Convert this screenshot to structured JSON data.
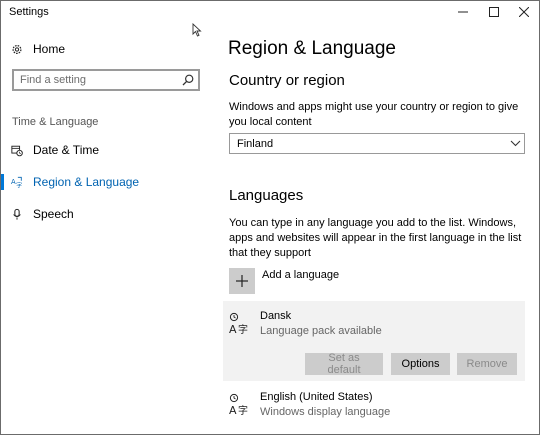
{
  "window": {
    "title": "Settings"
  },
  "sidebar": {
    "home_label": "Home",
    "search_placeholder": "Find a setting",
    "section_label": "Time & Language",
    "items": [
      {
        "label": "Date & Time",
        "icon": "calendar-clock-icon"
      },
      {
        "label": "Region & Language",
        "icon": "region-language-icon",
        "selected": true
      },
      {
        "label": "Speech",
        "icon": "microphone-icon"
      }
    ]
  },
  "main": {
    "title": "Region & Language",
    "country": {
      "heading": "Country or region",
      "description": "Windows and apps might use your country or region to give you local content",
      "selected": "Finland"
    },
    "languages": {
      "heading": "Languages",
      "description": "You can type in any language you add to the list. Windows, apps and websites will appear in the first language in the list that they support",
      "add_label": "Add a language",
      "items": [
        {
          "name": "Dansk",
          "status": "Language pack available"
        },
        {
          "name": "English (United States)",
          "status": "Windows display language"
        }
      ],
      "buttons": {
        "set_default": "Set as default",
        "options": "Options",
        "remove": "Remove"
      }
    }
  },
  "colors": {
    "accent": "#0078d7",
    "selected_row_bg": "#f2f2f2",
    "button_bg": "#cccccc"
  }
}
